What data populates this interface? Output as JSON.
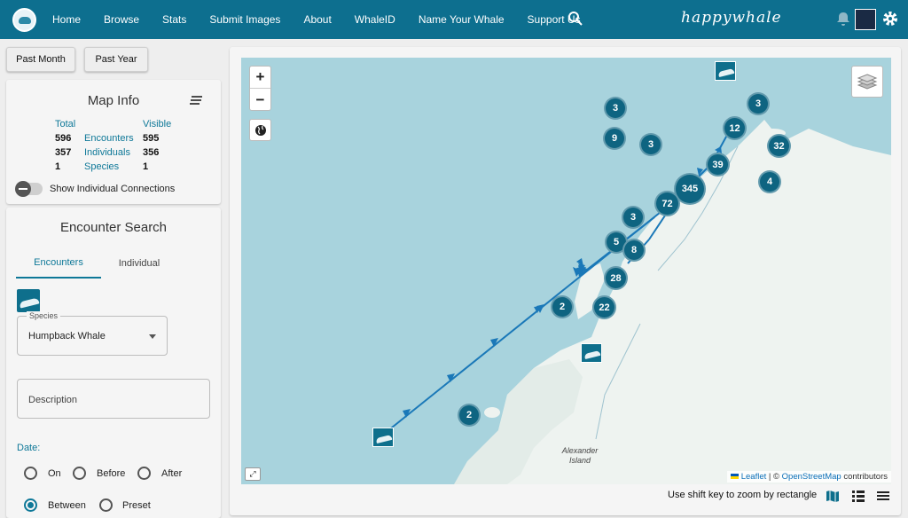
{
  "nav": {
    "items": [
      "Home",
      "Browse",
      "Stats",
      "Submit Images",
      "About",
      "WhaleID",
      "Name Your Whale",
      "Support Us"
    ],
    "brand": "happywhale"
  },
  "quick": {
    "past_month": "Past Month",
    "past_year": "Past Year"
  },
  "map_info": {
    "title": "Map Info",
    "col_total": "Total",
    "col_visible": "Visible",
    "rows": [
      {
        "total": "596",
        "label": "Encounters",
        "visible": "595"
      },
      {
        "total": "357",
        "label": "Individuals",
        "visible": "356"
      },
      {
        "total": "1",
        "label": "Species",
        "visible": "1"
      }
    ],
    "toggle_label": "Show Individual Connections"
  },
  "search": {
    "title": "Encounter Search",
    "tabs": [
      "Encounters",
      "Individual"
    ],
    "species_label": "Species",
    "species_value": "Humpback Whale",
    "description_placeholder": "Description",
    "date_label": "Date:",
    "date_options": [
      "On",
      "Before",
      "After",
      "Between",
      "Preset"
    ],
    "date_selected": "Between"
  },
  "map": {
    "zoom_in": "+",
    "zoom_out": "−",
    "clusters": [
      "3",
      "3",
      "9",
      "3",
      "12",
      "32",
      "39",
      "345",
      "4",
      "72",
      "3",
      "5",
      "8",
      "28",
      "2",
      "22",
      "2"
    ],
    "place_label": "Alexander\nIsland",
    "attribution": {
      "leaflet": "Leaflet",
      "sep": " | © ",
      "osm": "OpenStreetMap",
      "tail": " contributors"
    },
    "hint": "Use shift key to zoom by rectangle"
  },
  "colors": {
    "brand": "#0d6f8f",
    "cluster": "#0e6481",
    "track": "#1a78b8",
    "sea": "#a8d3dd",
    "land": "#eef3f0"
  }
}
